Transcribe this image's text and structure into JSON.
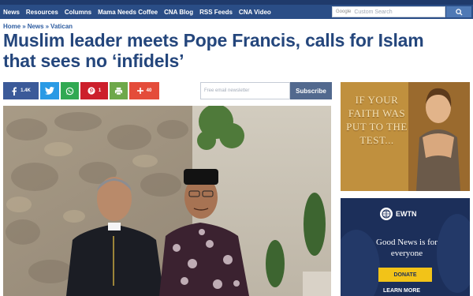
{
  "nav": {
    "items": [
      {
        "label": "News"
      },
      {
        "label": "Resources"
      },
      {
        "label": "Columns"
      },
      {
        "label": "Mama Needs Coffee"
      },
      {
        "label": "CNA Blog"
      },
      {
        "label": "RSS Feeds"
      },
      {
        "label": "CNA Video"
      }
    ],
    "search_google": "Google",
    "search_placeholder": "Custom Search",
    "search_icon": "search-icon"
  },
  "breadcrumb": {
    "items": [
      "Home",
      "News",
      "Vatican"
    ],
    "separator": "»"
  },
  "article": {
    "headline": "Muslim leader meets Pope Francis, calls for Islam that sees no ‘infidels’"
  },
  "share": {
    "facebook_count": "1.4K",
    "pinterest_count": "1",
    "more_count": "40",
    "icons": [
      "facebook-icon",
      "twitter-icon",
      "whatsapp-icon",
      "pinterest-icon",
      "print-icon",
      "plus-icon"
    ]
  },
  "newsletter": {
    "placeholder": "Free email newsletter",
    "button_label": "Subscribe"
  },
  "ad_faith": {
    "text": "IF YOUR FAITH WAS PUT TO THE TEST..."
  },
  "ad_ewtn": {
    "brand": "EWTN",
    "tagline": "Good News is for everyone",
    "donate_label": "DONATE",
    "learn_more_label": "LEARN MORE"
  },
  "colors": {
    "nav_bg": "#2a4d86",
    "headline": "#24467c",
    "link": "#2e5da1",
    "facebook": "#3b5a99",
    "twitter": "#2a9ae5",
    "whatsapp": "#31a952",
    "pinterest": "#cc1f2b",
    "print": "#6ea84a",
    "more": "#e44c3a",
    "donate": "#f2c318"
  }
}
